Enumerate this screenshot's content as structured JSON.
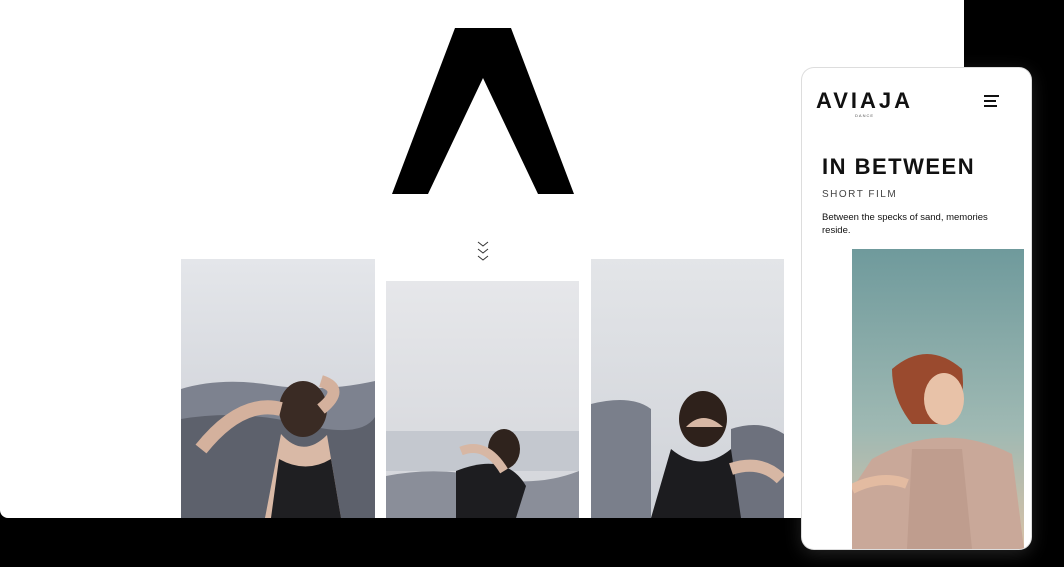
{
  "mobile": {
    "brand": "AVIAJA",
    "brand_sub": "DANCE",
    "title": "IN BETWEEN",
    "subtitle": "SHORT FILM",
    "description": "Between the specks of sand, memories reside."
  },
  "icons": {
    "logo": "aviaja-a-mark",
    "scroll": "chevron-triple-down-icon",
    "menu": "hamburger-menu-icon"
  },
  "colors": {
    "background": "#000000",
    "page": "#ffffff",
    "text": "#111111"
  }
}
